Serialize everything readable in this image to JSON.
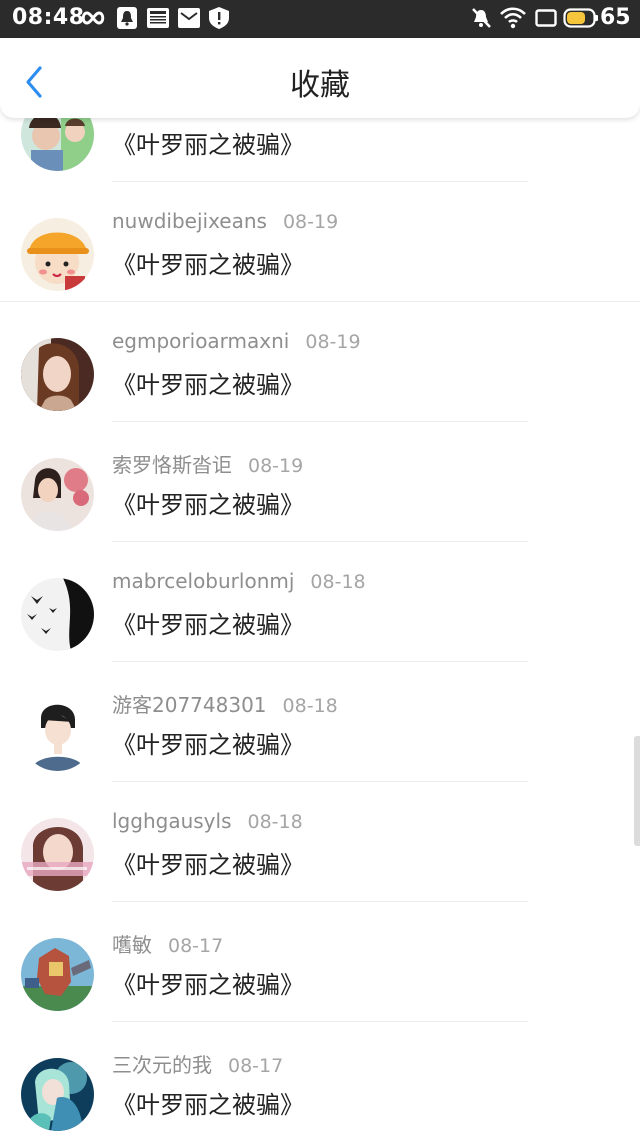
{
  "status_bar": {
    "time": "08:48",
    "battery_percent": "65",
    "icons": [
      "infinity-icon",
      "notification-icon",
      "news-icon",
      "mail-icon",
      "shield-icon",
      "mute-icon",
      "wifi-icon",
      "screen-icon",
      "battery-icon"
    ]
  },
  "header": {
    "title": "收藏",
    "back_icon": "chevron-left-icon",
    "accent_color": "#2e8ef0"
  },
  "items": [
    {
      "user": "",
      "date": "",
      "text": "《叶罗丽之被骗》",
      "avatar": "photo-two-girls"
    },
    {
      "user": "nuwdibejixeans",
      "date": "08-19",
      "text": "《叶罗丽之被骗》",
      "avatar": "cartoon-girl-yellow-hat"
    },
    {
      "user": "egmporioarmaxni",
      "date": "08-19",
      "text": "《叶罗丽之被骗》",
      "avatar": "photo-girl-portrait"
    },
    {
      "user": "索罗恪斯沓讵",
      "date": "08-19",
      "text": "《叶罗丽之被骗》",
      "avatar": "photo-child-flowers"
    },
    {
      "user": "mabrceloburlonmj",
      "date": "08-18",
      "text": "《叶罗丽之被骗》",
      "avatar": "bw-silhouette-birds"
    },
    {
      "user": "游客207748301",
      "date": "08-18",
      "text": "《叶罗丽之被骗》",
      "avatar": "anime-boy"
    },
    {
      "user": "lgghgausyls",
      "date": "08-18",
      "text": "《叶罗丽之被骗》",
      "avatar": "photo-girl-pink"
    },
    {
      "user": "嚿敏",
      "date": "08-17",
      "text": "《叶罗丽之被骗》",
      "avatar": "game-mech"
    },
    {
      "user": "三次元的我",
      "date": "08-17",
      "text": "《叶罗丽之被骗》",
      "avatar": "anime-blue-couple"
    }
  ]
}
